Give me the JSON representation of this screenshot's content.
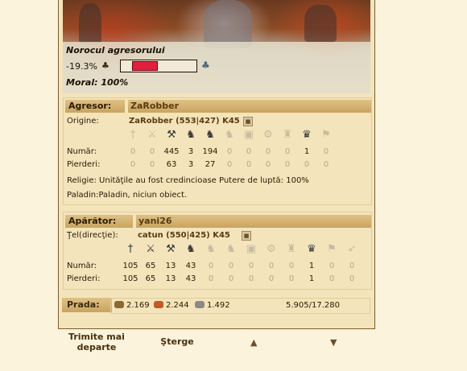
{
  "luck": {
    "title": "Norocul agresorului",
    "value": "-19.3%",
    "bad_icon": "clover-bad-icon",
    "good_icon": "clover-good-icon",
    "level_percent": -19.3
  },
  "morale": "Moral: 100%",
  "attacker": {
    "label": "Agresor:",
    "player": "ZaRobber",
    "origin_label": "Origine:",
    "village": "ZaRobber (553|427) K45",
    "count_label": "Număr:",
    "loss_label": "Pierderi:",
    "counts": [
      "0",
      "0",
      "445",
      "3",
      "194",
      "0",
      "0",
      "0",
      "0",
      "1",
      "0"
    ],
    "losses": [
      "0",
      "0",
      "63",
      "3",
      "27",
      "0",
      "0",
      "0",
      "0",
      "0",
      "0"
    ],
    "faith": "Religie: Unităţile au fost credincioase Putere de luptă: 100%",
    "paladin": "Paladin:Paladin, niciun obiect."
  },
  "defender": {
    "label": "Apărător:",
    "player": "yani26",
    "target_label": "Ţel(direcţie):",
    "village": "catun (550|425) K45",
    "count_label": "Număr:",
    "loss_label": "Pierderi:",
    "counts": [
      "105",
      "65",
      "13",
      "43",
      "0",
      "0",
      "0",
      "0",
      "0",
      "1",
      "0",
      "0"
    ],
    "losses": [
      "105",
      "65",
      "13",
      "43",
      "0",
      "0",
      "0",
      "0",
      "0",
      "1",
      "0",
      "0"
    ]
  },
  "loot": {
    "label": "Prada:",
    "wood": "2.169",
    "clay": "2.244",
    "iron": "1.492",
    "total": "5.905/17.280",
    "colors": {
      "wood": "#8a6a30",
      "clay": "#c25a22",
      "iron": "#8a8a8a"
    }
  },
  "actions": {
    "forward": "Trimite mai departe",
    "delete": "Şterge",
    "prev": "▲",
    "next": "▼"
  },
  "attacker_units": [
    "spear-icon",
    "sword-icon",
    "axe-icon",
    "scout-icon",
    "light-cavalry-icon",
    "heavy-cavalry-icon",
    "ram-icon",
    "catapult-icon",
    "knight-icon",
    "noble-icon",
    "militia-icon"
  ],
  "defender_units": [
    "spear-icon",
    "sword-icon",
    "axe-icon",
    "scout-icon",
    "light-cavalry-icon",
    "heavy-cavalry-icon",
    "ram-icon",
    "catapult-icon",
    "knight-icon",
    "noble-icon",
    "militia-icon",
    "archer-icon"
  ]
}
